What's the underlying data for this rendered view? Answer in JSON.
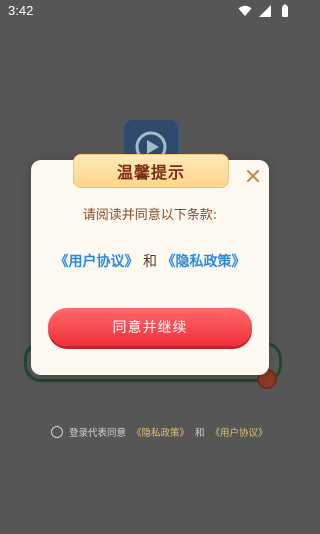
{
  "status_bar": {
    "time": "3:42"
  },
  "dialog": {
    "title": "温馨提示",
    "notice": "请阅读并同意以下条款:",
    "user_agreement": "《用户协议》",
    "and": "和",
    "privacy_policy": "《隐私政策》",
    "continue_label": "同意并继续"
  },
  "agreement_row": {
    "prefix": "登录代表同意",
    "privacy": "《隐私政策》",
    "and": "和",
    "user": "《用户协议》"
  },
  "colors": {
    "accent_red": "#ef2d3a",
    "link_blue": "#2a8ae0",
    "title_brown": "#7a2e18"
  }
}
